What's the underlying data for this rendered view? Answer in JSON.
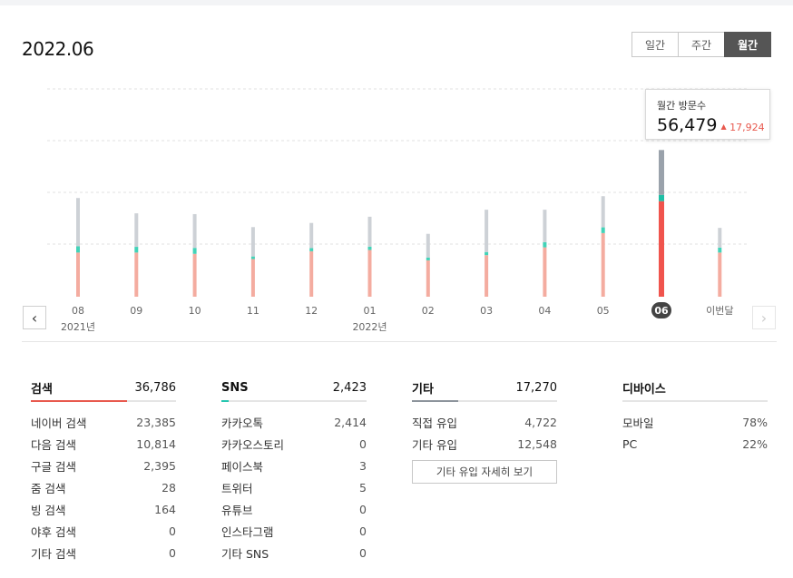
{
  "period_title": "2022.06",
  "period_tabs": [
    {
      "label": "일간",
      "active": false
    },
    {
      "label": "주간",
      "active": false
    },
    {
      "label": "월간",
      "active": true
    }
  ],
  "tooltip": {
    "label": "월간 방문수",
    "value": "56,479",
    "change": "17,924"
  },
  "colors": {
    "accent": "#f0544d",
    "gray": "#9aa2ab",
    "teal": "#42d3b8",
    "salmon": "#f4aca0",
    "light_gray": "#cdd1d6"
  },
  "chart_data": {
    "type": "bar",
    "categories": [
      "08",
      "09",
      "10",
      "11",
      "12",
      "01",
      "02",
      "03",
      "04",
      "05",
      "06",
      "이번달"
    ],
    "year_labels": [
      {
        "index": 0,
        "label": "2021년"
      },
      {
        "index": 5,
        "label": "2022년"
      }
    ],
    "selected_index": 10,
    "grid": true,
    "ylim": [
      0,
      80000
    ],
    "series": [
      {
        "key": "search",
        "values": [
          17000,
          17000,
          16500,
          14500,
          17500,
          18000,
          14000,
          16000,
          19000,
          24500,
          36786,
          17000
        ]
      },
      {
        "key": "sns",
        "values": [
          2400,
          2200,
          2300,
          1000,
          1200,
          1300,
          1100,
          1200,
          2000,
          2200,
          2423,
          1900
        ]
      },
      {
        "key": "other",
        "values": [
          18600,
          12900,
          13000,
          11300,
          9700,
          11500,
          9100,
          16300,
          12500,
          12000,
          17270,
          7600
        ]
      }
    ]
  },
  "stats": [
    {
      "title": "검색",
      "total": "36,786",
      "bar_fraction": 0.66,
      "bar_color": "#e8594e",
      "rows": [
        {
          "label": "네이버 검색",
          "value": "23,385"
        },
        {
          "label": "다음 검색",
          "value": "10,814"
        },
        {
          "label": "구글 검색",
          "value": "2,395"
        },
        {
          "label": "줌 검색",
          "value": "28"
        },
        {
          "label": "빙 검색",
          "value": "164"
        },
        {
          "label": "야후 검색",
          "value": "0"
        },
        {
          "label": "기타 검색",
          "value": "0"
        }
      ]
    },
    {
      "title": "SNS",
      "total": "2,423",
      "bar_fraction": 0.05,
      "bar_color": "#26c6b0",
      "rows": [
        {
          "label": "카카오톡",
          "value": "2,414"
        },
        {
          "label": "카카오스토리",
          "value": "0"
        },
        {
          "label": "페이스북",
          "value": "3"
        },
        {
          "label": "트위터",
          "value": "5"
        },
        {
          "label": "유튜브",
          "value": "0"
        },
        {
          "label": "인스타그램",
          "value": "0"
        },
        {
          "label": "기타 SNS",
          "value": "0"
        }
      ]
    },
    {
      "title": "기타",
      "total": "17,270",
      "bar_fraction": 0.32,
      "bar_color": "#8d949c",
      "rows": [
        {
          "label": "직접 유입",
          "value": "4,722"
        },
        {
          "label": "기타 유입",
          "value": "12,548"
        }
      ],
      "button": "기타 유입 자세히 보기"
    },
    {
      "title": "디바이스",
      "total": "",
      "bar_fraction": 0,
      "bar_color": "#8d949c",
      "rows": [
        {
          "label": "모바일",
          "value": "78%"
        },
        {
          "label": "PC",
          "value": "22%"
        }
      ]
    }
  ]
}
